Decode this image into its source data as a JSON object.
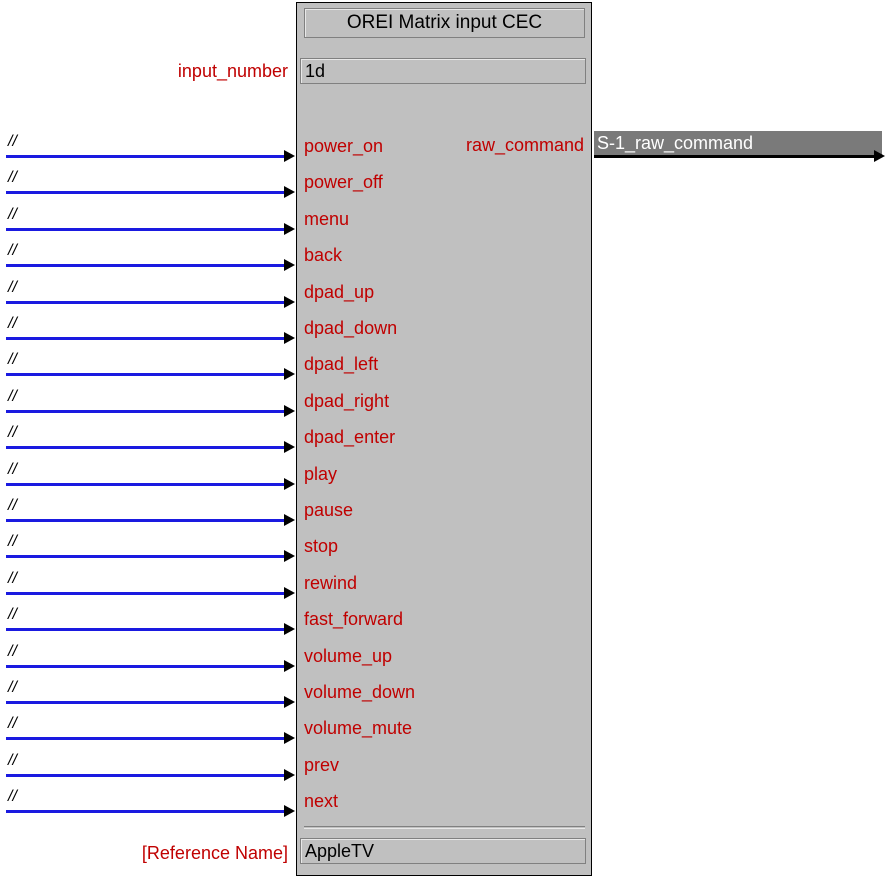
{
  "module": {
    "title": "OREI Matrix input CEC",
    "params": [
      {
        "label": "input_number",
        "value": "1d"
      },
      {
        "label": "[Reference Name]",
        "value": "AppleTV"
      }
    ]
  },
  "inputs": [
    {
      "signal": "//",
      "name": "power_on"
    },
    {
      "signal": "//",
      "name": "power_off"
    },
    {
      "signal": "//",
      "name": "menu"
    },
    {
      "signal": "//",
      "name": "back"
    },
    {
      "signal": "//",
      "name": "dpad_up"
    },
    {
      "signal": "//",
      "name": "dpad_down"
    },
    {
      "signal": "//",
      "name": "dpad_left"
    },
    {
      "signal": "//",
      "name": "dpad_right"
    },
    {
      "signal": "//",
      "name": "dpad_enter"
    },
    {
      "signal": "//",
      "name": "play"
    },
    {
      "signal": "//",
      "name": "pause"
    },
    {
      "signal": "//",
      "name": "stop"
    },
    {
      "signal": "//",
      "name": "rewind"
    },
    {
      "signal": "//",
      "name": "fast_forward"
    },
    {
      "signal": "//",
      "name": "volume_up"
    },
    {
      "signal": "//",
      "name": "volume_down"
    },
    {
      "signal": "//",
      "name": "volume_mute"
    },
    {
      "signal": "//",
      "name": "prev"
    },
    {
      "signal": "//",
      "name": "next"
    }
  ],
  "outputs": [
    {
      "name": "raw_command",
      "signal": "S-1_raw_command"
    }
  ],
  "colors": {
    "label_red": "#c00000",
    "wire_blue": "#1a1ae0",
    "block_gray": "#c0c0c0",
    "output_signal_bg": "#7a7a7a"
  }
}
